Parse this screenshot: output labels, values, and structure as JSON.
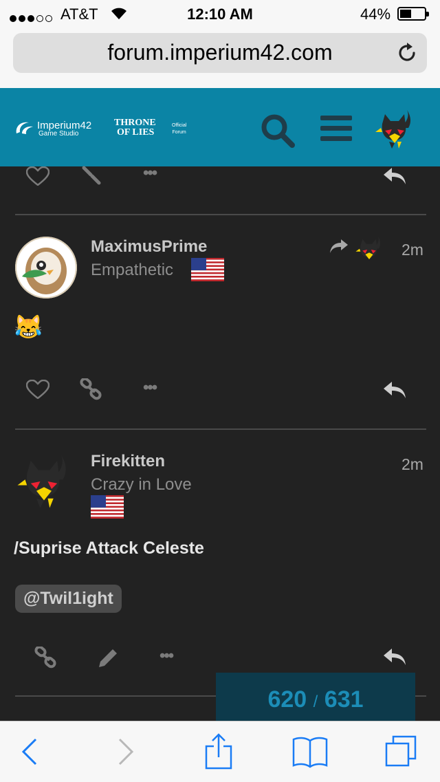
{
  "status_bar": {
    "carrier": "AT&T",
    "time": "12:10 AM",
    "battery_percent": "44%",
    "signal_bars_filled": 3,
    "signal_bars_total": 5
  },
  "browser": {
    "url": "forum.imperium42.com"
  },
  "header": {
    "brand_name": "Imperium42",
    "brand_sub": "Game Studio",
    "game_line1": "THRONE",
    "game_line2": "OF LIES",
    "official_line1": "Official",
    "official_line2": "Forum",
    "accent_color": "#0b84a5"
  },
  "posts": [
    {
      "username": "MaximusPrime",
      "user_title": "Empathetic",
      "time": "2m",
      "content_emoji": "😹"
    },
    {
      "username": "Firekitten",
      "user_title": "Crazy in Love",
      "time": "2m",
      "content_text": "/Suprise Attack Celeste",
      "mention": "@Twil1ight"
    }
  ],
  "timeline": {
    "current": "620",
    "separator": "/",
    "total": "631"
  }
}
